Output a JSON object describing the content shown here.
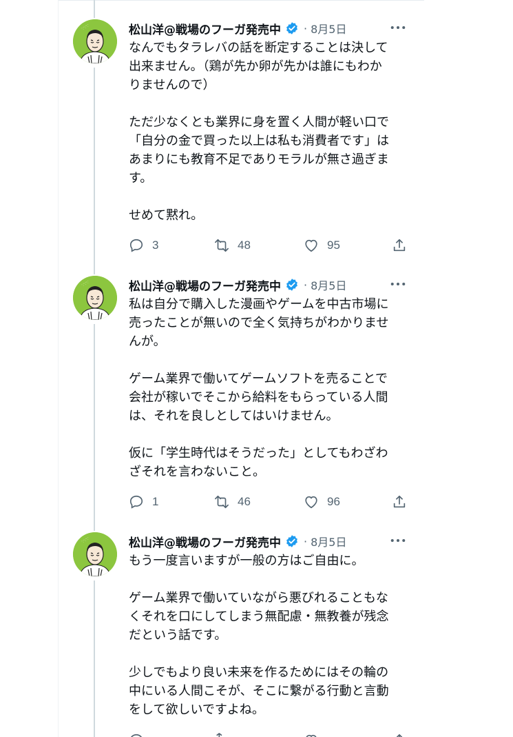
{
  "tweets": [
    {
      "author": "松山洋@戦場のフーガ発売中",
      "separator": "·",
      "date": "8月5日",
      "lines": [
        "なんでもタラレバの話を断定することは決して",
        "出来ません。（鶏が先か卵が先かは誰にもわか",
        "りませんので）",
        "",
        "ただ少なくとも業界に身を置く人間が軽い口で",
        "「自分の金で買った以上は私も消費者です」は",
        "あまりにも教育不足でありモラルが無さ過ぎま",
        "す。",
        "",
        "せめて黙れ。"
      ],
      "replies": "3",
      "retweets": "48",
      "likes": "95"
    },
    {
      "author": "松山洋@戦場のフーガ発売中",
      "separator": "·",
      "date": "8月5日",
      "lines": [
        "私は自分で購入した漫画やゲームを中古市場に",
        "売ったことが無いので全く気持ちがわかりませ",
        "んが。",
        "",
        "ゲーム業界で働いてゲームソフトを売ることで",
        "会社が稼いでそこから給料をもらっている人間",
        "は、それを良しとしてはいけません。",
        "",
        "仮に「学生時代はそうだった」としてもわざわ",
        "ざそれを言わないこと。"
      ],
      "replies": "1",
      "retweets": "46",
      "likes": "96"
    },
    {
      "author": "松山洋@戦場のフーガ発売中",
      "separator": "·",
      "date": "8月5日",
      "lines": [
        "もう一度言いますが一般の方はご自由に。",
        "",
        "ゲーム業界で働いていながら悪びれることもな",
        "くそれを口にしてしまう無配慮・無教養が残念",
        "だという話です。",
        "",
        "少しでもより良い未来を作るためにはその輪の",
        "中にいる人間こそが、そこに繋がる行動と言動",
        "をして欲しいですよね。"
      ]
    }
  ],
  "icons": {
    "verified": "verified-badge-icon",
    "more": "more-dots-icon",
    "reply": "reply-bubble-icon",
    "retweet": "retweet-icon",
    "like": "heart-icon",
    "share": "share-icon"
  },
  "colors": {
    "verified": "#1d9bf0",
    "muted": "#536471",
    "text": "#0f1419",
    "avatar_bg": "#8cc63f",
    "thread_line": "#cfd9de"
  }
}
